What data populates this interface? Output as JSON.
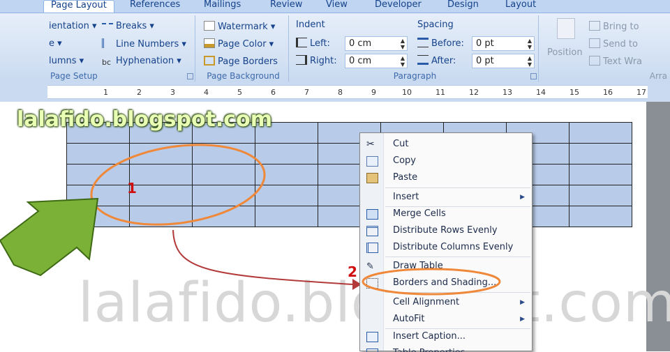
{
  "tabs": [
    {
      "label": "Page Layout",
      "active": true
    },
    {
      "label": "References"
    },
    {
      "label": "Mailings"
    },
    {
      "label": "Review"
    },
    {
      "label": "View"
    },
    {
      "label": "Developer"
    },
    {
      "label": "Design"
    },
    {
      "label": "Layout"
    }
  ],
  "ribbon": {
    "page_setup": {
      "label": "Page Setup",
      "items": [
        "ientation",
        "e",
        "lumns"
      ],
      "col2": [
        "Breaks",
        "Line Numbers",
        "Hyphenation"
      ]
    },
    "page_background": {
      "label": "Page Background",
      "items": [
        "Watermark",
        "Page Color",
        "Page Borders"
      ]
    },
    "paragraph": {
      "label": "Paragraph",
      "indent_title": "Indent",
      "spacing_title": "Spacing",
      "left_label": "Left:",
      "right_label": "Right:",
      "before_label": "Before:",
      "after_label": "After:",
      "left_value": "0 cm",
      "right_value": "0 cm",
      "before_value": "0 pt",
      "after_value": "0 pt"
    },
    "arrange": {
      "label": "Arra",
      "position": "Position",
      "bring": "Bring to",
      "send": "Send to",
      "wrap": "Text Wra"
    }
  },
  "ruler_labels": [
    "1",
    "2",
    "3",
    "4",
    "5",
    "6",
    "7",
    "8",
    "9",
    "10",
    "11",
    "12",
    "13",
    "14",
    "15",
    "16",
    "17"
  ],
  "blog_text": "lalafido.blogspot.com",
  "watermark_text": "lalafido.blogspot.com",
  "annotations": {
    "one": "1",
    "two": "2"
  },
  "context_menu": [
    {
      "label": "Cut",
      "icon": "scissors-icon",
      "key": "t"
    },
    {
      "label": "Copy",
      "icon": "copy-icon"
    },
    {
      "label": "Paste",
      "icon": "paste-icon"
    },
    {
      "label": "Insert",
      "submenu": true
    },
    {
      "label": "Merge Cells",
      "icon": "merge-cells-icon"
    },
    {
      "label": "Distribute Rows Evenly",
      "icon": "distribute-rows-icon"
    },
    {
      "label": "Distribute Columns Evenly",
      "icon": "distribute-columns-icon"
    },
    {
      "label": "Draw Table",
      "icon": "pencil-icon"
    },
    {
      "label": "Borders and Shading...",
      "icon": "borders-icon"
    },
    {
      "label": "Cell Alignment",
      "submenu": true
    },
    {
      "label": "AutoFit",
      "submenu": true
    },
    {
      "label": "Insert Caption...",
      "icon": "caption-icon"
    },
    {
      "label": "Table Properties...",
      "icon": "table-properties-icon"
    }
  ],
  "colors": {
    "ribbon": "#d3e1f3",
    "table_fill": "#b8cce9",
    "highlight_orange": "#f0883a",
    "arrow_green": "#6a9a2a",
    "annotation_red": "#d01010"
  }
}
